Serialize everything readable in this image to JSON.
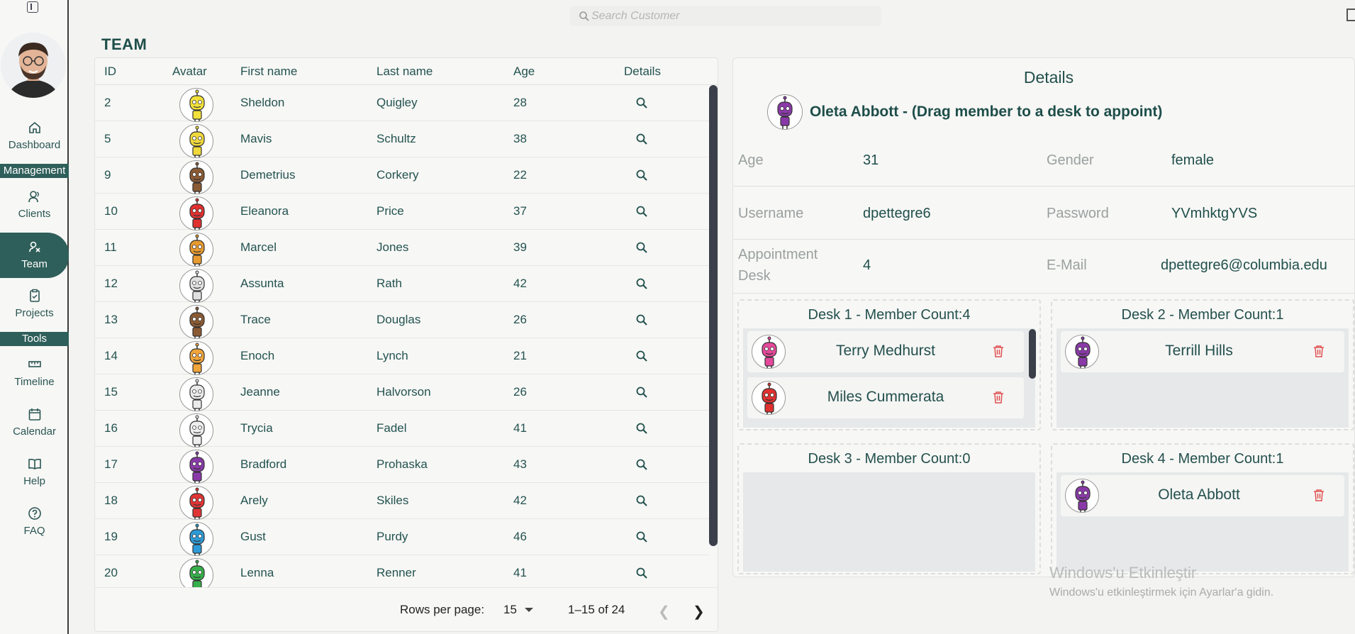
{
  "search": {
    "placeholder": "Search Customer"
  },
  "page_title": "TEAM",
  "sidebar": {
    "items": [
      {
        "key": "dashboard",
        "label": "Dashboard",
        "icon": "home-icon"
      },
      {
        "key": "clients",
        "label": "Clients",
        "icon": "users-icon"
      },
      {
        "key": "team",
        "label": "Team",
        "icon": "team-icon"
      },
      {
        "key": "projects",
        "label": "Projects",
        "icon": "clipboard-icon"
      },
      {
        "key": "timeline",
        "label": "Timeline",
        "icon": "ruler-icon"
      },
      {
        "key": "calendar",
        "label": "Calendar",
        "icon": "calendar-icon"
      },
      {
        "key": "help",
        "label": "Help",
        "icon": "book-icon"
      },
      {
        "key": "faq",
        "label": "FAQ",
        "icon": "question-icon"
      }
    ],
    "sections": {
      "management": "Management",
      "tools": "Tools"
    }
  },
  "table": {
    "headers": {
      "id": "ID",
      "avatar": "Avatar",
      "first": "First name",
      "last": "Last name",
      "age": "Age",
      "details": "Details"
    },
    "rows": [
      {
        "id": "2",
        "first": "Sheldon",
        "last": "Quigley",
        "age": "28",
        "color": "#f2e13a"
      },
      {
        "id": "5",
        "first": "Mavis",
        "last": "Schultz",
        "age": "38",
        "color": "#f0d93c"
      },
      {
        "id": "9",
        "first": "Demetrius",
        "last": "Corkery",
        "age": "22",
        "color": "#8a5a34"
      },
      {
        "id": "10",
        "first": "Eleanora",
        "last": "Price",
        "age": "37",
        "color": "#e03030"
      },
      {
        "id": "11",
        "first": "Marcel",
        "last": "Jones",
        "age": "39",
        "color": "#e79a2e"
      },
      {
        "id": "12",
        "first": "Assunta",
        "last": "Rath",
        "age": "42",
        "color": "#e0e0e0"
      },
      {
        "id": "13",
        "first": "Trace",
        "last": "Douglas",
        "age": "26",
        "color": "#8b5a33"
      },
      {
        "id": "14",
        "first": "Enoch",
        "last": "Lynch",
        "age": "21",
        "color": "#f0a43a"
      },
      {
        "id": "15",
        "first": "Jeanne",
        "last": "Halvorson",
        "age": "26",
        "color": "#eaeaea"
      },
      {
        "id": "16",
        "first": "Trycia",
        "last": "Fadel",
        "age": "41",
        "color": "#eeeeee"
      },
      {
        "id": "17",
        "first": "Bradford",
        "last": "Prohaska",
        "age": "43",
        "color": "#8a3aa8"
      },
      {
        "id": "18",
        "first": "Arely",
        "last": "Skiles",
        "age": "42",
        "color": "#e03535"
      },
      {
        "id": "19",
        "first": "Gust",
        "last": "Purdy",
        "age": "46",
        "color": "#2d9bd8"
      },
      {
        "id": "20",
        "first": "Lenna",
        "last": "Renner",
        "age": "41",
        "color": "#36b04a"
      }
    ],
    "footer": {
      "rows_per_page_label": "Rows per page:",
      "rows_per_page_value": "15",
      "range": "1–15 of 24"
    }
  },
  "details": {
    "title": "Details",
    "member_heading": "Oleta Abbott - (Drag member to a desk to appoint)",
    "member_color": "#8a3aa8",
    "fields": {
      "age_label": "Age",
      "age": "31",
      "gender_label": "Gender",
      "gender": "female",
      "username_label": "Username",
      "username": "dpettegre6",
      "password_label": "Password",
      "password": "YVmhktgYVS",
      "desk_label_1": "Appointment",
      "desk_label_2": "Desk",
      "desk": "4",
      "email_label": "E-Mail",
      "email": "dpettegre6@columbia.edu"
    },
    "desks": [
      {
        "title": "Desk 1 - Member Count:4",
        "members": [
          {
            "name": "Terry Medhurst",
            "color": "#e5489a"
          },
          {
            "name": "Miles Cummerata",
            "color": "#e03030"
          }
        ]
      },
      {
        "title": "Desk 2 - Member Count:1",
        "members": [
          {
            "name": "Terrill Hills",
            "color": "#8a3aa8"
          }
        ]
      },
      {
        "title": "Desk 3 - Member Count:0",
        "members": []
      },
      {
        "title": "Desk 4 - Member Count:1",
        "members": [
          {
            "name": "Oleta Abbott",
            "color": "#8a3aa8"
          }
        ]
      }
    ]
  },
  "watermark": {
    "line1": "Windows'u Etkinleştir",
    "line2": "Windows'u etkinleştirmek için Ayarlar'a gidin."
  }
}
